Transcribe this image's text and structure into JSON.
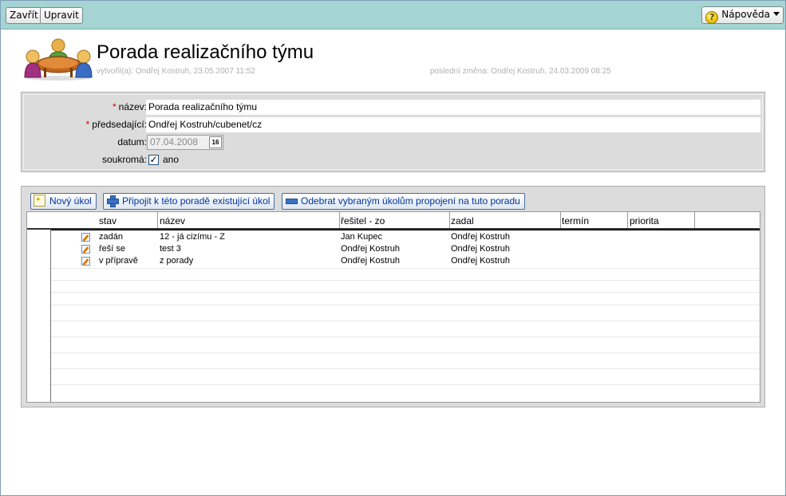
{
  "toolbar": {
    "close_label": "Zavřít",
    "edit_label": "Upravit",
    "help_label": "Nápověda",
    "help_icon": "?"
  },
  "header": {
    "title": "Porada realizačního týmu",
    "created": "vytvořil(a): Ondřej Kostruh, 23.05.2007 11:52",
    "modified": "poslední změna: Ondřej Kostruh, 24.03.2009 08:25"
  },
  "form": {
    "name_label": "název:",
    "name_value": "Porada realizačního týmu",
    "chair_label": "předsedající:",
    "chair_value": "Ondřej Kostruh/cubenet/cz",
    "date_label": "datum:",
    "date_value": "07.04.2008",
    "calendar_day": "16",
    "private_label": "soukromá:",
    "private_value": "ano",
    "private_checked": true,
    "required_mark": "*"
  },
  "tasks": {
    "new_task_label": "Nový úkol",
    "attach_label": "Připojit k této poradě existující úkol",
    "detach_label": "Odebrat vybraným úkolům propojení na tuto poradu",
    "columns": [
      "stav",
      "název",
      "řešitel - zo",
      "zadal",
      "termín",
      "priorita"
    ],
    "rows": [
      {
        "stav": "zadán",
        "nazev": "12 - já cizímu - Z",
        "resitel": "Jan Kupec",
        "zadal": "Ondřej Kostruh",
        "termin": "",
        "priorita": ""
      },
      {
        "stav": "řeší se",
        "nazev": "test 3",
        "resitel": "Ondřej Kostruh",
        "zadal": "Ondřej Kostruh",
        "termin": "",
        "priorita": ""
      },
      {
        "stav": "v přípravě",
        "nazev": "z porady",
        "resitel": "Ondřej Kostruh",
        "zadal": "Ondřej Kostruh",
        "termin": "",
        "priorita": ""
      }
    ]
  },
  "colors": {
    "topbar": "#a4d5d2",
    "link": "#003399",
    "required": "#cc0000",
    "meta": "#b0b0b0"
  }
}
